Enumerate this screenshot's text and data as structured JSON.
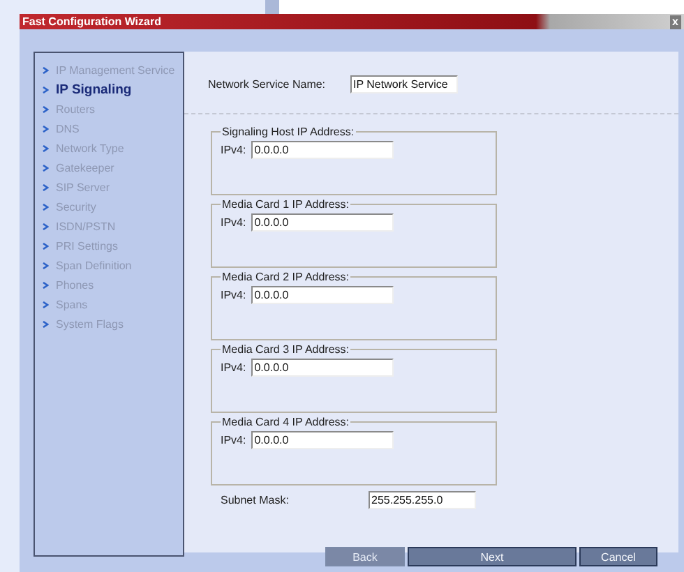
{
  "window": {
    "title": "Fast Configuration Wizard",
    "close": "x"
  },
  "sidebar": {
    "items": [
      {
        "label": "IP Management Service",
        "selected": false
      },
      {
        "label": "IP Signaling",
        "selected": true
      },
      {
        "label": "Routers",
        "selected": false
      },
      {
        "label": "DNS",
        "selected": false
      },
      {
        "label": "Network Type",
        "selected": false
      },
      {
        "label": "Gatekeeper",
        "selected": false
      },
      {
        "label": "SIP Server",
        "selected": false
      },
      {
        "label": "Security",
        "selected": false
      },
      {
        "label": "ISDN/PSTN",
        "selected": false
      },
      {
        "label": "PRI Settings",
        "selected": false
      },
      {
        "label": "Span Definition",
        "selected": false
      },
      {
        "label": "Phones",
        "selected": false
      },
      {
        "label": "Spans",
        "selected": false
      },
      {
        "label": "System Flags",
        "selected": false
      }
    ]
  },
  "network_service_name": {
    "label": "Network Service Name:",
    "value": "IP Network Service"
  },
  "groups": [
    {
      "legend": "Signaling Host IP Address:",
      "label": "IPv4:",
      "value": "0.0.0.0"
    },
    {
      "legend": "Media Card 1 IP Address:",
      "label": "IPv4:",
      "value": "0.0.0.0"
    },
    {
      "legend": "Media Card 2 IP Address:",
      "label": "IPv4:",
      "value": "0.0.0.0"
    },
    {
      "legend": "Media Card 3 IP Address:",
      "label": "IPv4:",
      "value": "0.0.0.0"
    },
    {
      "legend": "Media Card 4 IP Address:",
      "label": "IPv4:",
      "value": "0.0.0.0"
    }
  ],
  "subnet_mask": {
    "label": "Subnet Mask:",
    "value": "255.255.255.0"
  },
  "buttons": [
    {
      "label": "Back",
      "disabled": true
    },
    {
      "label": "Next",
      "disabled": false
    },
    {
      "label": "Cancel",
      "disabled": false
    }
  ]
}
